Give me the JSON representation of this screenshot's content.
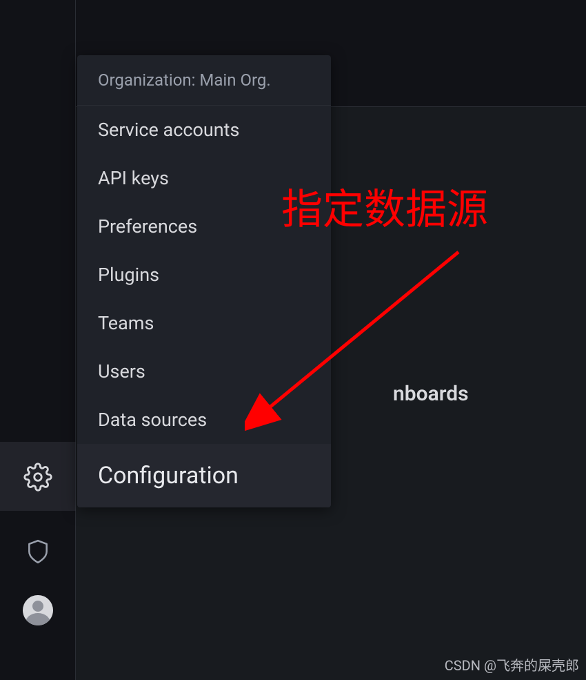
{
  "app": {
    "background_partial_text": "nboards"
  },
  "sidebar": {
    "header": "Organization: Main Org.",
    "items": [
      {
        "label": "Service accounts"
      },
      {
        "label": "API keys"
      },
      {
        "label": "Preferences"
      },
      {
        "label": "Plugins"
      },
      {
        "label": "Teams"
      },
      {
        "label": "Users"
      },
      {
        "label": "Data sources"
      }
    ],
    "footer": "Configuration"
  },
  "annotation": {
    "text": "指定数据源"
  },
  "watermark": "CSDN @飞奔的屎壳郎"
}
